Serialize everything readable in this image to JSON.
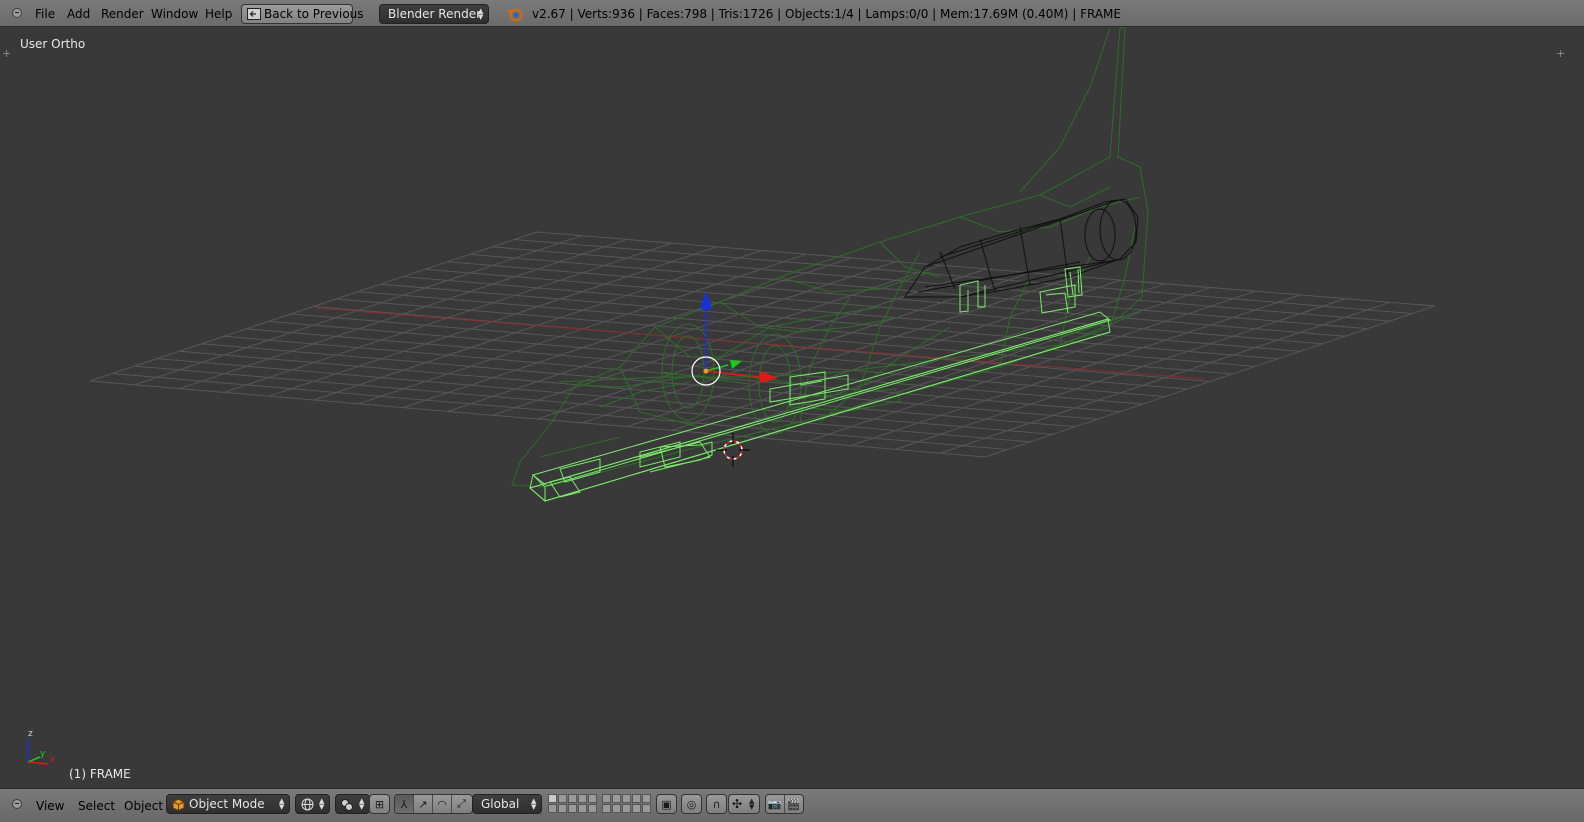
{
  "top_header": {
    "menus": [
      "File",
      "Add",
      "Render",
      "Window",
      "Help"
    ],
    "back_button_label": "Back to Previous",
    "render_engine": "Blender Render",
    "stats": "v2.67 | Verts:936 | Faces:798 | Tris:1726 | Objects:1/4 | Lamps:0/0 | Mem:17.69M (0.40M) | FRAME"
  },
  "viewport": {
    "view_label": "User Ortho",
    "frame_label": "(1) FRAME",
    "axis_labels": {
      "x": "x",
      "y": "y",
      "z": "z"
    }
  },
  "bottom_header": {
    "menus": [
      "View",
      "Select",
      "Object"
    ],
    "mode": "Object Mode",
    "transform_orientation": "Global"
  },
  "colors": {
    "viewport_bg": "#393939",
    "grid_line": "#555555",
    "x_axis": "#8f2a2a",
    "selected_wire": "#7bea6b",
    "wire_dark_green": "#2f7a2a",
    "wire_black": "#111111",
    "gizmo_x": "#e01818",
    "gizmo_y": "#1cc81c",
    "gizmo_z": "#1a2fe0"
  }
}
